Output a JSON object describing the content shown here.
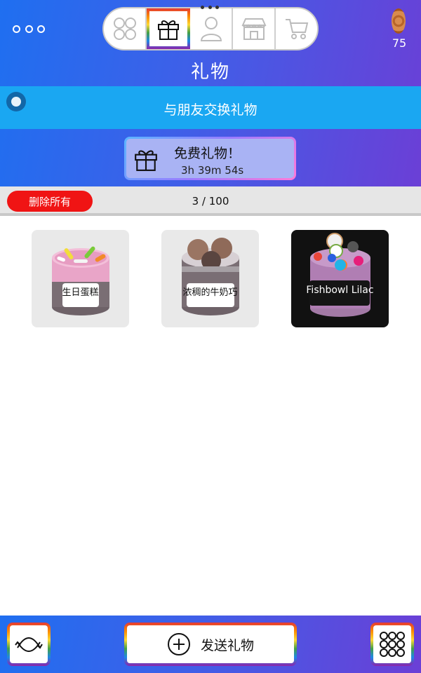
{
  "header": {
    "title": "礼物",
    "coins": "75",
    "nav_tabs": [
      {
        "name": "home",
        "icon": "four-circles-icon"
      },
      {
        "name": "gifts",
        "icon": "gift-icon",
        "active": true
      },
      {
        "name": "profile",
        "icon": "person-icon"
      },
      {
        "name": "shop",
        "icon": "store-icon"
      },
      {
        "name": "cart",
        "icon": "cart-icon"
      }
    ]
  },
  "exchange": {
    "label": "与朋友交换礼物"
  },
  "free_gift": {
    "title": "免费礼物！",
    "timer": "3h 39m 54s"
  },
  "controls": {
    "delete_all": "删除所有",
    "count": "3 / 100"
  },
  "gifts": [
    {
      "label": "生日蛋糕",
      "theme": "pink-cake"
    },
    {
      "label": "浓稠的牛奶巧",
      "theme": "chocolate"
    },
    {
      "label": "Fishbowl Lilac",
      "theme": "lilac"
    }
  ],
  "footer": {
    "send_label": "发送礼物"
  },
  "colors": {
    "header_start": "#1f6ff0",
    "header_end": "#6b3fd6",
    "exchange_bar": "#1aa7f2",
    "delete_button": "#f01414"
  }
}
